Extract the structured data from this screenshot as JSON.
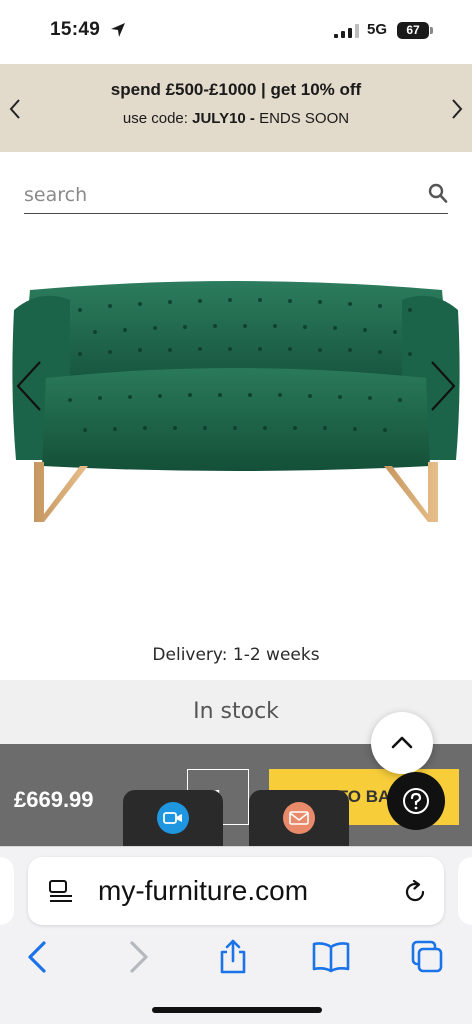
{
  "status_bar": {
    "time": "15:49",
    "network": "5G",
    "battery": "67"
  },
  "promo": {
    "line1": "spend £500-£1000 | get 10% off",
    "line2_prefix": "use code: ",
    "code": "JULY10 -",
    "line2_suffix": " ENDS SOON"
  },
  "search": {
    "placeholder": "search"
  },
  "product": {
    "delivery": "Delivery: 1-2 weeks",
    "stock": "In stock",
    "price": "£669.99",
    "quantity": "1",
    "add_to_basket_visible": "TO BA"
  },
  "browser": {
    "url": "my-furniture.com"
  },
  "colors": {
    "promo_bg": "#e2dacb",
    "sofa_green": "#1f6b4f",
    "add_button": "#f7cd3a",
    "price_bar": "#6c6c6c",
    "safari_blue": "#1a73e8"
  },
  "icons": {
    "location": "location-arrow-icon",
    "signal": "cellular-signal-icon",
    "search": "search-icon",
    "prev": "chevron-left-icon",
    "next": "chevron-right-icon",
    "scroll_top": "chevron-up-icon",
    "help": "question-mark-icon",
    "video": "video-call-icon",
    "mail": "envelope-icon",
    "reader": "reader-mode-icon",
    "reload": "reload-icon",
    "back": "back-arrow-icon",
    "forward": "forward-arrow-icon",
    "share": "share-icon",
    "bookmarks": "book-icon",
    "tabs": "tabs-icon"
  }
}
